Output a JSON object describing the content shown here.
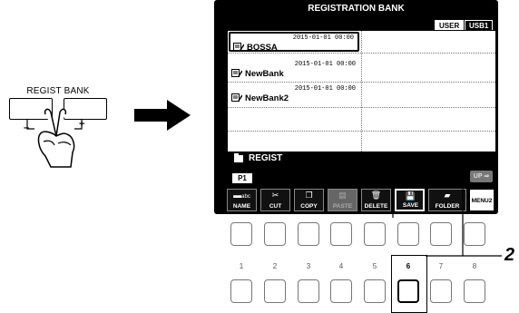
{
  "panel": {
    "regist_bank_label": "REGIST BANK",
    "minus": "–",
    "plus": "+"
  },
  "screen": {
    "title": "REGISTRATION BANK",
    "tabs": [
      {
        "label": "USER",
        "active": true
      },
      {
        "label": "USB1",
        "active": false
      }
    ],
    "files": [
      {
        "date": "2015-01-01 00:00",
        "name": "BOSSA",
        "selected": true
      },
      {
        "date": "2015-01-01 00:00",
        "name": "NewBank",
        "selected": false
      },
      {
        "date": "2015-01-01 00:00",
        "name": "NewBank2",
        "selected": false
      }
    ],
    "current_folder": "REGIST",
    "page": "P1",
    "up_label": "UP",
    "function_keys": [
      {
        "label": "NAME",
        "icon": "abc",
        "disabled": false
      },
      {
        "label": "CUT",
        "icon": "scissors",
        "disabled": false
      },
      {
        "label": "COPY",
        "icon": "copy",
        "disabled": false
      },
      {
        "label": "PASTE",
        "icon": "paste",
        "disabled": true
      },
      {
        "label": "DELETE",
        "icon": "trash",
        "disabled": false
      },
      {
        "label": "SAVE",
        "icon": "floppy",
        "disabled": false
      },
      {
        "label": "FOLDER",
        "icon": "folder",
        "disabled": false
      }
    ],
    "menu_label": "MENU2"
  },
  "buttons": {
    "numbers": [
      "1",
      "2",
      "3",
      "4",
      "5",
      "6",
      "7",
      "8"
    ],
    "highlighted": "6"
  },
  "step_number": "2",
  "colors": {
    "screen_bg": "#000000",
    "list_bg": "#ffffff",
    "disabled_key": "#666666"
  }
}
